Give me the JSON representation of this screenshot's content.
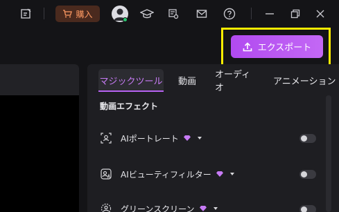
{
  "toolbar": {
    "buy_label": "購入"
  },
  "export": {
    "label": "エクスポート"
  },
  "tabs": [
    {
      "label": "マジックツール",
      "active": true
    },
    {
      "label": "動画",
      "active": false
    },
    {
      "label": "オーディオ",
      "active": false
    },
    {
      "label": "アニメーション",
      "active": false
    }
  ],
  "section": {
    "title": "動画エフェクト"
  },
  "effects": [
    {
      "label": "AIポートレート",
      "icon": "portrait-icon",
      "enabled": false
    },
    {
      "label": "AIビューティフィルター",
      "icon": "ai-beauty-icon",
      "enabled": false
    },
    {
      "label": "グリーンスクリーン",
      "icon": "green-screen-icon",
      "enabled": false
    }
  ],
  "colors": {
    "accent": "#b863f3",
    "buy_text": "#ff9a63",
    "highlight": "#ffee00",
    "online": "#28c76f"
  }
}
